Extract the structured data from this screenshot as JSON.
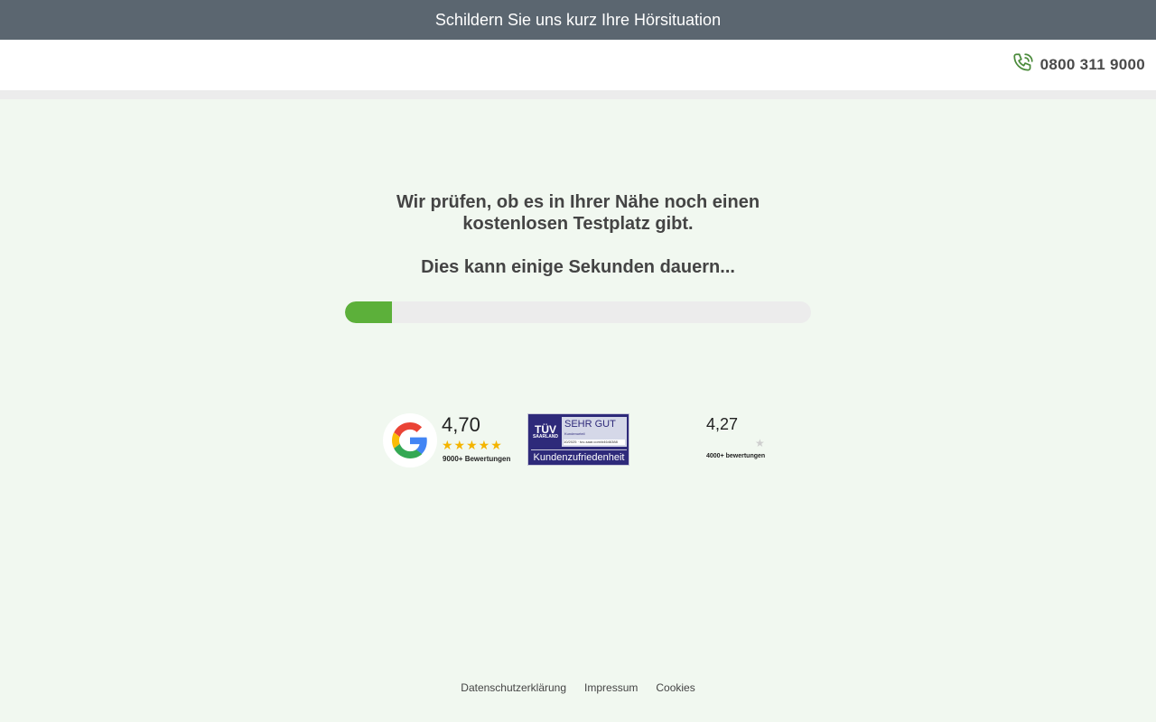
{
  "topbar": {
    "title": "Schildern Sie uns kurz Ihre Hörsituation"
  },
  "header": {
    "phone": "0800 311 9000",
    "phone_icon": "phone-icon"
  },
  "main": {
    "heading": "Wir prüfen, ob es in Ihrer Nähe noch einen kostenlosen Testplatz gibt.",
    "subheading": "Dies kann einige Sekunden dauern...",
    "progress_fraction": 0.1
  },
  "trust": {
    "google": {
      "score": "4,70",
      "stars": "★★★★★",
      "count": "9000+ Bewertungen",
      "icon": "google-icon"
    },
    "tuv": {
      "logo_main": "TÜV",
      "logo_sub": "SAARLAND",
      "grade": "SEHR GUT",
      "small": "Kundenurteil",
      "url": "10/2025 · tuv-saar.com/#4646388",
      "bottom": "Kundenzufriedenheit"
    },
    "other": {
      "score": "4,27",
      "star": "★",
      "count": "4000+ bewertungen"
    }
  },
  "footer": {
    "links": [
      "Datenschutzerklärung",
      "Impressum",
      "Cookies"
    ]
  },
  "colors": {
    "topbar": "#5b6670",
    "background": "#f1f8f0",
    "progress": "#5cb03a",
    "tuv": "#2e2a7a",
    "stars": "#f4b400"
  }
}
